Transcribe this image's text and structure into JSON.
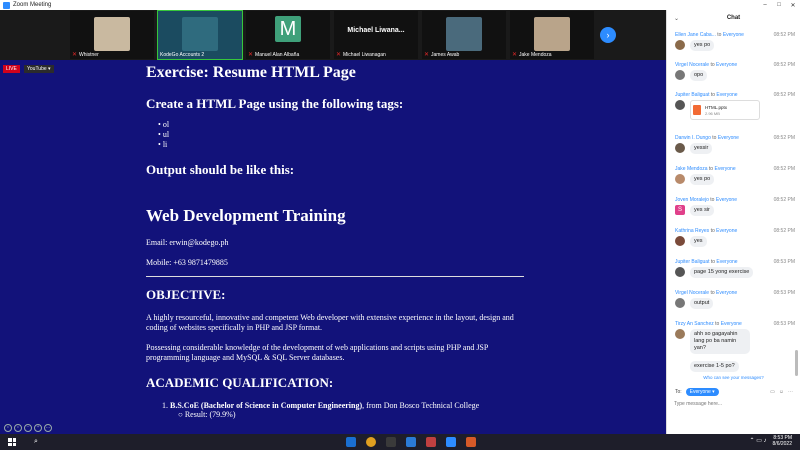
{
  "window": {
    "title": "Zoom Meeting",
    "controls": [
      "–",
      "□",
      "✕"
    ]
  },
  "video_strip": {
    "tiles": [
      {
        "name": "Whistner",
        "muted": true,
        "type": "face"
      },
      {
        "name": "KodeGo Accounts 2",
        "muted": false,
        "type": "face",
        "active": true
      },
      {
        "name": "Manuel Alan Albaña",
        "muted": true,
        "type": "letter",
        "letter": "M"
      },
      {
        "name": "Michael Liwanagan",
        "muted": true,
        "type": "name-only",
        "big": "Michael  Liwana..."
      },
      {
        "name": "James Awab",
        "muted": true,
        "type": "face"
      },
      {
        "name": "Jake Mendoza",
        "muted": true,
        "type": "face"
      }
    ],
    "next_icon": "chevron-right-icon"
  },
  "share": {
    "live_label": "LIVE",
    "youtube_label": "YouTube ▾",
    "exercise_title": "Exercise: Resume HTML Page",
    "instructions": "Create a HTML Page using the following tags:",
    "tags": [
      "ol",
      "ul",
      "li"
    ],
    "output_label": "Output should be like this:",
    "resume_title": "Web Development Training",
    "email": "Email: erwin@kodego.ph",
    "mobile": "Mobile: +63 9871479885",
    "objective_heading": "OBJECTIVE:",
    "objective_p1": "A highly resourceful, innovative and competent Web developer with extensive experience in the layout, design and coding of websites specifically in PHP and JSP format.",
    "objective_p2": "Possessing considerable knowledge of the development of web applications and scripts using PHP and JSP programming language and MySQL & SQL Server databases.",
    "academic_heading": "ACADEMIC QUALIFICATION:",
    "academic_degree": "B.S.CoE (Bachelor of Science in Computer Engineering)",
    "academic_school": ", from Don Bosco Technical College",
    "academic_result": "Result: (79.9%)"
  },
  "chat": {
    "title": "Chat",
    "messages": [
      {
        "from": "Ellen Jane Caba...",
        "to": "Everyone",
        "time": "08:52 PM",
        "text": "yes po"
      },
      {
        "from": "Virgel Nocerale",
        "to": "Everyone",
        "time": "08:52 PM",
        "text": "opo"
      },
      {
        "from": "Jupiter Baliguat",
        "to": "Everyone",
        "time": "08:52 PM",
        "file_name": "HTML.pptx",
        "file_size": "2.96 MB"
      },
      {
        "from": "Darwin I. Dungo",
        "to": "Everyone",
        "time": "08:52 PM",
        "text": "yessir"
      },
      {
        "from": "Jake Mendoza",
        "to": "Everyone",
        "time": "08:52 PM",
        "text": "yes po"
      },
      {
        "from": "Joven Moralejo",
        "to": "Everyone",
        "time": "08:52 PM",
        "text": "yes sir",
        "avatar_letter": "S"
      },
      {
        "from": "Kathrina Reyes",
        "to": "Everyone",
        "time": "08:52 PM",
        "text": "yes"
      },
      {
        "from": "Jupiter Baliguat",
        "to": "Everyone",
        "time": "08:53 PM",
        "text": "page 15 yong exercise"
      },
      {
        "from": "Virgel Nocerale",
        "to": "Everyone",
        "time": "08:53 PM",
        "text": "output"
      },
      {
        "from": "Tirzy An Sanchez",
        "to": "Everyone",
        "time": "08:53 PM",
        "text": "ahh so gagayahin lang po ba namin yan?",
        "text2": "exercise 1-5 po?"
      }
    ],
    "who_can_see": "Who can see your messages?",
    "to_label": "To:",
    "to_value": "Everyone ▾",
    "input_placeholder": "Type message here..."
  },
  "taskbar": {
    "time": "8:53 PM",
    "date": "8/6/2022",
    "app_colors": [
      "#1a6fd1",
      "#e0a020",
      "#3a3a3a",
      "#2b7bd6",
      "#c04040",
      "#2d8cff",
      "#d65a28"
    ]
  }
}
